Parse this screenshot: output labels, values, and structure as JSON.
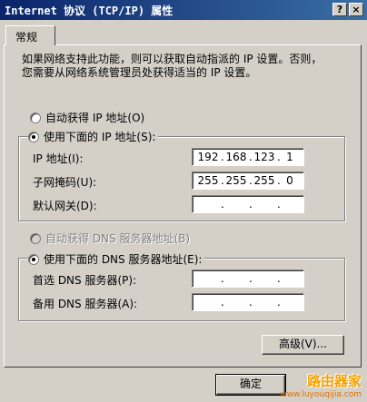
{
  "window": {
    "title": "Internet 协议 (TCP/IP) 属性",
    "help_button": "?",
    "close_button": "×"
  },
  "tabs": [
    {
      "label": "常规",
      "selected": true
    }
  ],
  "description": {
    "line1": "如果网络支持此功能，则可以获取自动指派的 IP 设置。否则，",
    "line2": "您需要从网络系统管理员处获得适当的 IP 设置。"
  },
  "ip": {
    "auto_label": "自动获得 IP 地址(O)",
    "manual_label": "使用下面的 IP 地址(S):",
    "auto_checked": false,
    "manual_checked": true,
    "address_label": "IP 地址(I):",
    "address": [
      "192",
      "168",
      "123",
      "1"
    ],
    "subnet_label": "子网掩码(U):",
    "subnet": [
      "255",
      "255",
      "255",
      "0"
    ],
    "gateway_label": "默认网关(D):",
    "gateway": [
      "",
      "",
      "",
      ""
    ]
  },
  "dns": {
    "auto_label": "自动获得 DNS 服务器地址(B)",
    "manual_label": "使用下面的 DNS 服务器地址(E):",
    "auto_checked": false,
    "auto_disabled": true,
    "manual_checked": true,
    "preferred_label": "首选 DNS 服务器(P):",
    "preferred": [
      "",
      "",
      "",
      ""
    ],
    "alternate_label": "备用 DNS 服务器(A):",
    "alternate": [
      "",
      "",
      "",
      ""
    ]
  },
  "buttons": {
    "advanced": "高级(V)...",
    "ok": "确定"
  },
  "watermark": {
    "main": "路由器家",
    "url": "www.luyouqijia.com"
  },
  "colors": {
    "face": "#d4d0c8",
    "title_start": "#0a246a",
    "title_end": "#3a6ea5",
    "watermark": "#f5a000"
  }
}
